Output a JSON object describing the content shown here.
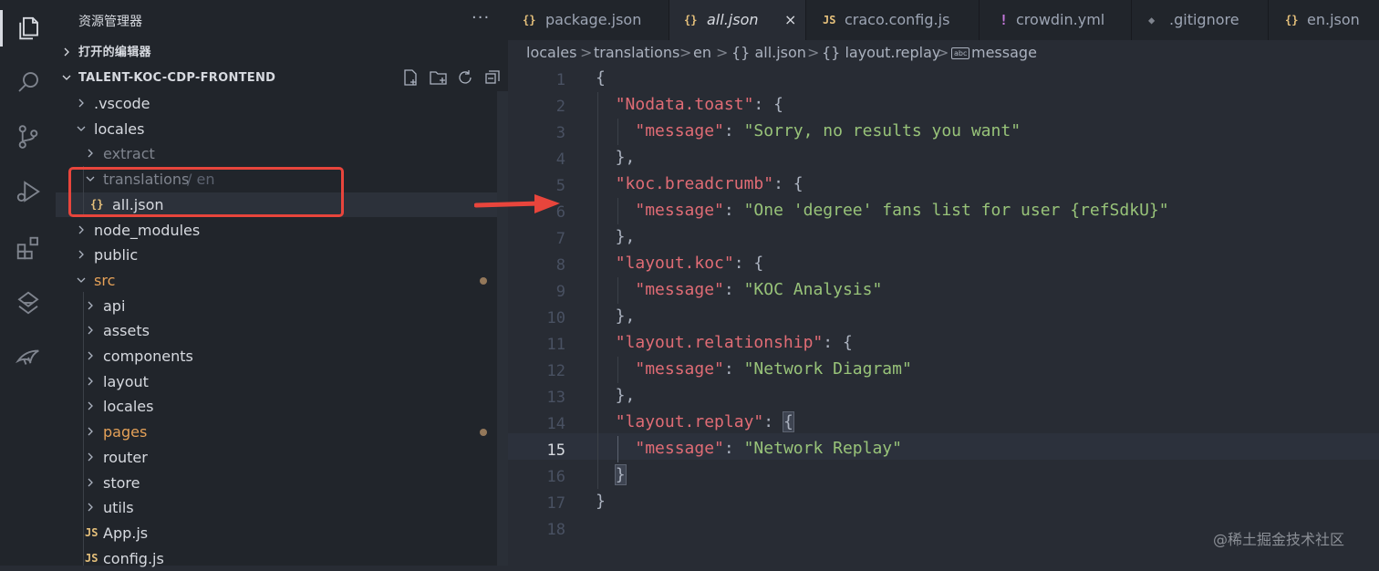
{
  "activity_bar": {
    "items": [
      {
        "icon": "files-icon"
      },
      {
        "icon": "search-icon"
      },
      {
        "icon": "source-control-icon"
      },
      {
        "icon": "run-debug-icon"
      },
      {
        "icon": "extensions-icon"
      },
      {
        "icon": "remote-icon"
      },
      {
        "icon": "bird-icon"
      }
    ]
  },
  "explorer": {
    "title": "资源管理器",
    "more": "···",
    "open_editors": "打开的编辑器",
    "project": "TALENT-KOC-CDP-FRONTEND"
  },
  "tree": [
    {
      "label": ".vscode",
      "type": "folder",
      "expanded": false,
      "level": 1
    },
    {
      "label": "locales",
      "type": "folder",
      "expanded": true,
      "level": 1
    },
    {
      "label": "extract",
      "type": "folder",
      "expanded": false,
      "level": 2,
      "dim": true
    },
    {
      "label": "translations",
      "suffix": "/ en",
      "type": "folder",
      "expanded": true,
      "level": 2,
      "dim": true
    },
    {
      "label": "all.json",
      "type": "json",
      "level": 3,
      "selected": true,
      "file_icon": "{}"
    },
    {
      "label": "node_modules",
      "type": "folder",
      "expanded": false,
      "level": 1
    },
    {
      "label": "public",
      "type": "folder",
      "expanded": false,
      "level": 1
    },
    {
      "label": "src",
      "type": "folder",
      "expanded": true,
      "level": 1,
      "modified": true
    },
    {
      "label": "api",
      "type": "folder",
      "expanded": false,
      "level": 2
    },
    {
      "label": "assets",
      "type": "folder",
      "expanded": false,
      "level": 2
    },
    {
      "label": "components",
      "type": "folder",
      "expanded": false,
      "level": 2
    },
    {
      "label": "layout",
      "type": "folder",
      "expanded": false,
      "level": 2
    },
    {
      "label": "locales",
      "type": "folder",
      "expanded": false,
      "level": 2
    },
    {
      "label": "pages",
      "type": "folder",
      "expanded": false,
      "level": 2,
      "modified": true
    },
    {
      "label": "router",
      "type": "folder",
      "expanded": false,
      "level": 2
    },
    {
      "label": "store",
      "type": "folder",
      "expanded": false,
      "level": 2
    },
    {
      "label": "utils",
      "type": "folder",
      "expanded": false,
      "level": 2
    },
    {
      "label": "App.js",
      "type": "js",
      "level": 2,
      "file_icon": "JS"
    },
    {
      "label": "config.js",
      "type": "js",
      "level": 2,
      "file_icon": "JS"
    }
  ],
  "tabs": [
    {
      "label": "package.json",
      "icon": "{}",
      "active": false
    },
    {
      "label": "all.json",
      "icon": "{}",
      "active": true,
      "close": "×"
    },
    {
      "label": "craco.config.js",
      "icon": "JS",
      "active": false
    },
    {
      "label": "crowdin.yml",
      "icon": "!",
      "active": false
    },
    {
      "label": ".gitignore",
      "icon": "◆",
      "active": false
    },
    {
      "label": "en.json",
      "icon": "{}",
      "active": false
    }
  ],
  "breadcrumbs": [
    "locales",
    "translations",
    "en",
    "{} all.json",
    "{} layout.replay",
    "message"
  ],
  "breadcrumb_sep": ">",
  "breadcrumb_last_icon": "abc",
  "editor": {
    "current_line": 15,
    "lines": [
      {
        "n": "1",
        "t": [
          {
            "c": "p",
            "v": "{"
          }
        ]
      },
      {
        "n": "2",
        "t": [
          {
            "c": "p",
            "v": "  "
          },
          {
            "c": "k",
            "v": "\"Nodata.toast\""
          },
          {
            "c": "p",
            "v": ": {"
          }
        ]
      },
      {
        "n": "3",
        "t": [
          {
            "c": "p",
            "v": "    "
          },
          {
            "c": "k",
            "v": "\"message\""
          },
          {
            "c": "p",
            "v": ": "
          },
          {
            "c": "s",
            "v": "\"Sorry, no results you want\""
          }
        ]
      },
      {
        "n": "4",
        "t": [
          {
            "c": "p",
            "v": "  },"
          }
        ]
      },
      {
        "n": "5",
        "t": [
          {
            "c": "p",
            "v": "  "
          },
          {
            "c": "k",
            "v": "\"koc.breadcrumb\""
          },
          {
            "c": "p",
            "v": ": {"
          }
        ]
      },
      {
        "n": "6",
        "t": [
          {
            "c": "p",
            "v": "    "
          },
          {
            "c": "k",
            "v": "\"message\""
          },
          {
            "c": "p",
            "v": ": "
          },
          {
            "c": "s",
            "v": "\"One 'degree' fans list for user {refSdkU}\""
          }
        ]
      },
      {
        "n": "7",
        "t": [
          {
            "c": "p",
            "v": "  },"
          }
        ]
      },
      {
        "n": "8",
        "t": [
          {
            "c": "p",
            "v": "  "
          },
          {
            "c": "k",
            "v": "\"layout.koc\""
          },
          {
            "c": "p",
            "v": ": {"
          }
        ]
      },
      {
        "n": "9",
        "t": [
          {
            "c": "p",
            "v": "    "
          },
          {
            "c": "k",
            "v": "\"message\""
          },
          {
            "c": "p",
            "v": ": "
          },
          {
            "c": "s",
            "v": "\"KOC Analysis\""
          }
        ]
      },
      {
        "n": "10",
        "t": [
          {
            "c": "p",
            "v": "  },"
          }
        ]
      },
      {
        "n": "11",
        "t": [
          {
            "c": "p",
            "v": "  "
          },
          {
            "c": "k",
            "v": "\"layout.relationship\""
          },
          {
            "c": "p",
            "v": ": {"
          }
        ]
      },
      {
        "n": "12",
        "t": [
          {
            "c": "p",
            "v": "    "
          },
          {
            "c": "k",
            "v": "\"message\""
          },
          {
            "c": "p",
            "v": ": "
          },
          {
            "c": "s",
            "v": "\"Network Diagram\""
          }
        ]
      },
      {
        "n": "13",
        "t": [
          {
            "c": "p",
            "v": "  },"
          }
        ]
      },
      {
        "n": "14",
        "t": [
          {
            "c": "p",
            "v": "  "
          },
          {
            "c": "k",
            "v": "\"layout.replay\""
          },
          {
            "c": "p",
            "v": ": "
          },
          {
            "c": "bm",
            "v": "{"
          }
        ]
      },
      {
        "n": "15",
        "t": [
          {
            "c": "p",
            "v": "    "
          },
          {
            "c": "k",
            "v": "\"message\""
          },
          {
            "c": "p",
            "v": ": "
          },
          {
            "c": "s",
            "v": "\"Network Replay\""
          }
        ]
      },
      {
        "n": "16",
        "t": [
          {
            "c": "p",
            "v": "  "
          },
          {
            "c": "bm",
            "v": "}"
          }
        ]
      },
      {
        "n": "17",
        "t": [
          {
            "c": "p",
            "v": "}"
          }
        ]
      },
      {
        "n": "18",
        "t": []
      }
    ]
  },
  "watermark": "@稀土掘金技术社区",
  "colors": {
    "key": "#e06c75",
    "string": "#98c379",
    "modified": "#e5a158",
    "json_icon": "#e5c07b",
    "yaml_icon": "#c678dd",
    "annotation": "#e8453c"
  }
}
